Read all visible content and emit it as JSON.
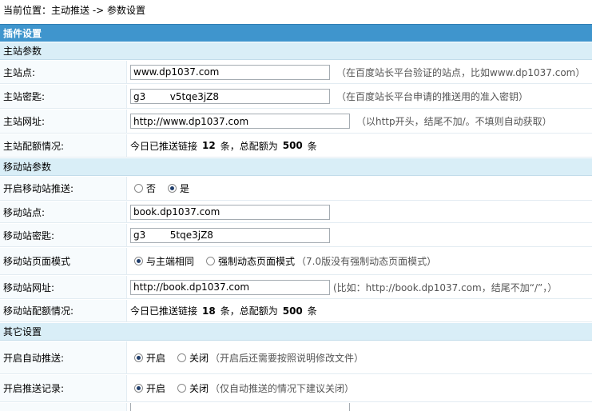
{
  "breadcrumb": {
    "prefix": "当前位置：",
    "path": "主动推送 -> 参数设置"
  },
  "title": "插件设置",
  "main_section": {
    "heading": "主站参数",
    "site": {
      "label": "主站点:",
      "value": "www.dp1037.com",
      "hint": "（在百度站长平台验证的站点，比如www.dp1037.com）"
    },
    "key": {
      "label": "主站密匙:",
      "value": "g3        v5tqe3jZ8",
      "hint": "（在百度站长平台申请的推送用的准入密钥）"
    },
    "url": {
      "label": "主站网址:",
      "value": "http://www.dp1037.com",
      "hint": "（以http开头，结尾不加/。不填则自动获取）"
    },
    "quota": {
      "label": "主站配额情况:",
      "text1": "今日已推送链接",
      "pushed": "12",
      "text2": "条，总配额为",
      "total": "500",
      "text3": "条"
    }
  },
  "mobile_section": {
    "heading": "移动站参数",
    "enable": {
      "label": "开启移动站推送:",
      "opt_no": "否",
      "opt_yes": "是",
      "selected": "是"
    },
    "site": {
      "label": "移动站点:",
      "value": "book.dp1037.com"
    },
    "key": {
      "label": "移动站密匙:",
      "value": "g3        5tqe3jZ8"
    },
    "mode": {
      "label": "移动站页面模式",
      "opt_same": "与主端相同",
      "opt_force": "强制动态页面模式",
      "hint": "（7.0版没有强制动态页面模式）",
      "selected": "与主端相同"
    },
    "url": {
      "label": "移动站网址:",
      "value": "http://book.dp1037.com",
      "hint": "(比如：http://book.dp1037.com，结尾不加“/”，）"
    },
    "quota": {
      "label": "移动站配额情况:",
      "text1": "今日已推送链接",
      "pushed": "18",
      "text2": "条，总配额为",
      "total": "500",
      "text3": "条"
    }
  },
  "other_section": {
    "heading": "其它设置",
    "auto_push": {
      "label": "开启自动推送:",
      "opt_on": "开启",
      "opt_off": "关闭",
      "hint": "（开启后还需要按照说明修改文件）",
      "selected": "开启"
    },
    "push_log": {
      "label": "开启推送记录:",
      "opt_on": "开启",
      "opt_off": "关闭",
      "hint": "（仅自动推送的情况下建议关闭）",
      "selected": "开启"
    }
  }
}
